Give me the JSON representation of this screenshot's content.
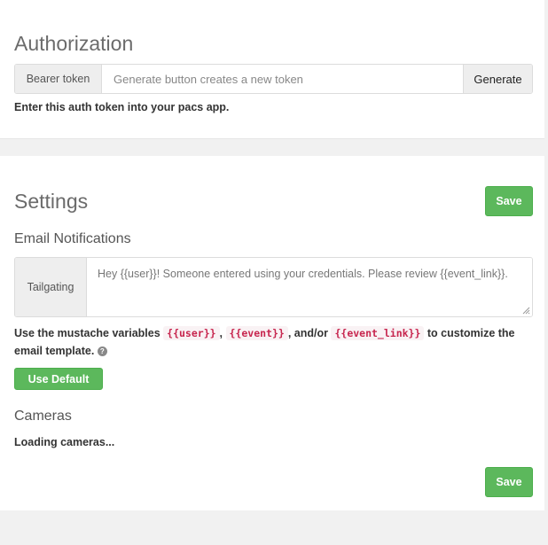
{
  "authorization": {
    "title": "Authorization",
    "token_label": "Bearer token",
    "token_placeholder": "Generate button creates a new token",
    "generate_label": "Generate",
    "help": "Enter this auth token into your pacs app."
  },
  "settings": {
    "title": "Settings",
    "save_label": "Save",
    "email_section_title": "Email Notifications",
    "tailgating_label": "Tailgating",
    "tailgating_text": "Hey {{user}}! Someone entered using your credentials. Please review {{event_link}}.",
    "help_prefix": "Use the mustache variables",
    "var_user": "{{user}}",
    "sep1": ",",
    "var_event": "{{event}}",
    "sep2": ", and/or",
    "var_event_link": "{{event_link}}",
    "help_suffix_line1": "to customize the",
    "help_suffix_line2": "email template.",
    "help_icon": "?",
    "use_default_label": "Use Default",
    "cameras_title": "Cameras",
    "cameras_status": "Loading cameras...",
    "save_bottom_label": "Save"
  },
  "colors": {
    "accent_green": "#5cb85c",
    "code_red": "#c7254e",
    "background": "#f1f1f1"
  }
}
